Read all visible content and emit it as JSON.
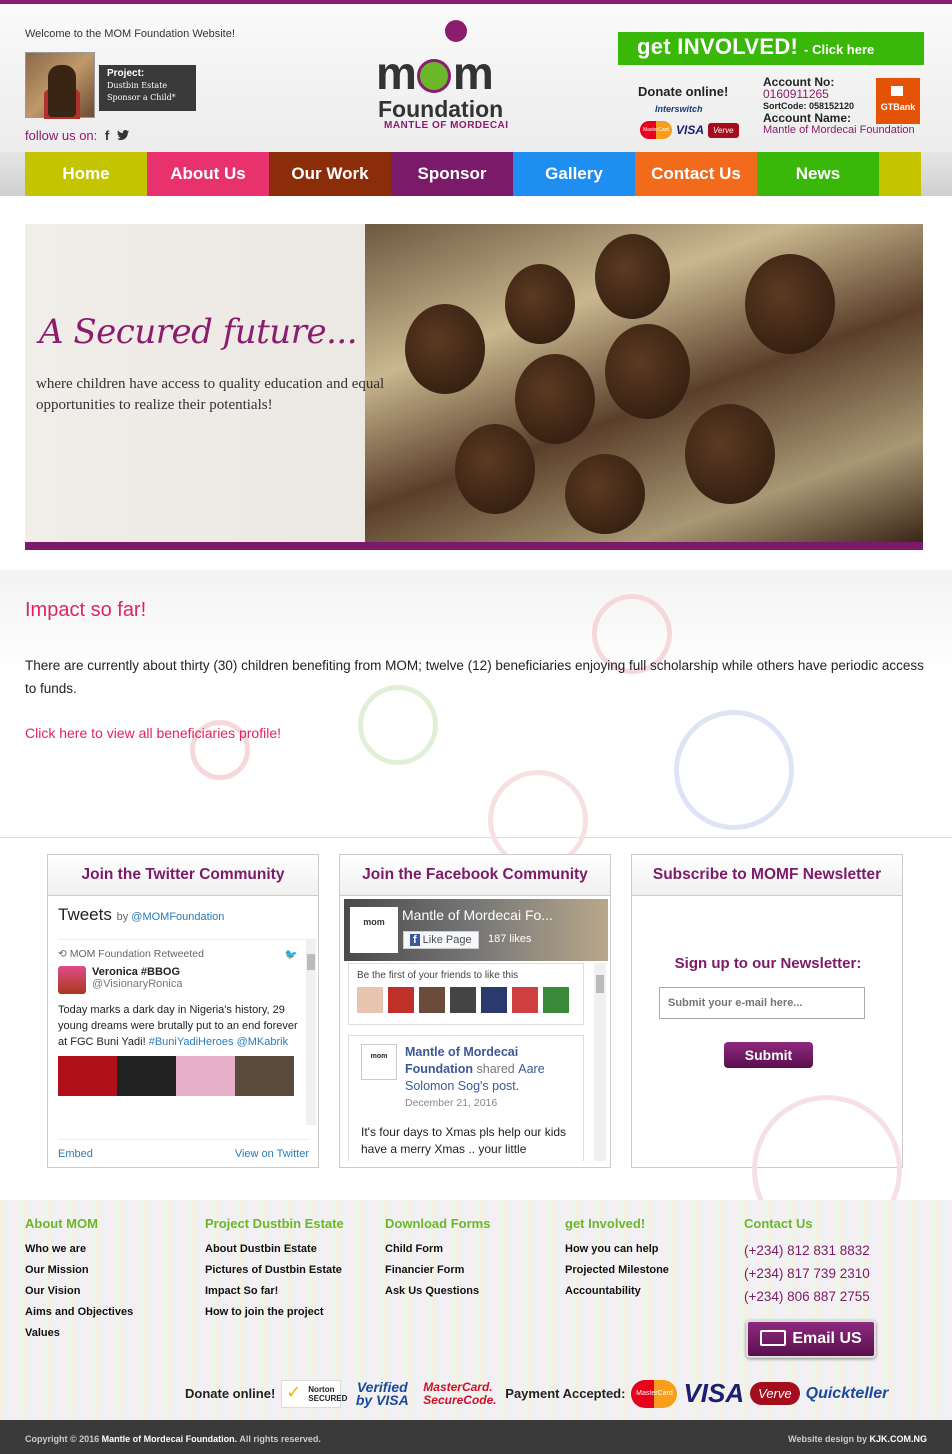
{
  "header": {
    "welcome": "Welcome to the MOM Foundation Website!",
    "project_label": "Project:",
    "project_name": "Dustbin Estate",
    "project_action": "Sponsor a Child*",
    "follow_label": "follow us on:",
    "social_icons": [
      "facebook-icon",
      "twitter-icon"
    ],
    "logo_word": "MOM",
    "logo_foundation": "Foundation",
    "logo_sub": "MANTLE OF MORDECAI",
    "get_involved": "get INVOLVED!",
    "get_involved_cta": "- Click here",
    "donate_label": "Donate online!",
    "interswitch": "Interswitch",
    "card_labels": {
      "mastercard": "MasterCard",
      "visa": "VISA",
      "verve": "Verve"
    },
    "account_no_label": "Account No:",
    "account_no": "0160911265",
    "sort_code": "SortCode: 058152120",
    "account_name_label": "Account Name:",
    "account_name": "Mantle of Mordecai Foundation",
    "bank": "GTBank"
  },
  "nav": [
    {
      "label": "Home",
      "color": "#c5c400"
    },
    {
      "label": "About Us",
      "color": "#e8326e"
    },
    {
      "label": "Our Work",
      "color": "#8a2d08"
    },
    {
      "label": "Sponsor",
      "color": "#7c1a6a"
    },
    {
      "label": "Gallery",
      "color": "#1e8ef0"
    },
    {
      "label": "Contact Us",
      "color": "#f26a1b"
    },
    {
      "label": "News",
      "color": "#3ab80a"
    }
  ],
  "banner": {
    "tagline": "A Secured future...",
    "description": "where children have access to quality education and equal opportunities to realize their potentials!"
  },
  "impact": {
    "title": "Impact so far!",
    "text": "There are currently about thirty (30) children benefiting from MOM; twelve (12) beneficiaries enjoying full scholarship while others have periodic access to funds.",
    "link": "Click here to view all beneficiaries profile!"
  },
  "twitter": {
    "heading": "Join the Twitter Community",
    "title": "Tweets",
    "by": "by",
    "handle": "@MOMFoundation",
    "retweeted": "MOM Foundation Retweeted",
    "user": "Veronica #BBOG",
    "user_handle": "@VisionaryRonica",
    "tweet": "Today marks a dark day in Nigeria's history, 29 young dreams were brutally put to an end forever at FGC Buni Yadi!",
    "hashtag": "#BuniYadiHeroes",
    "mention": "@MKabrik",
    "embed": "Embed",
    "view": "View on Twitter"
  },
  "facebook": {
    "heading": "Join the Facebook Community",
    "page_name": "Mantle of Mordecai Fo...",
    "like": "Like Page",
    "likes": "187 likes",
    "friends_text": "Be the first of your friends to like this",
    "post_author": "Mantle of Mordecai Foundation",
    "post_shared": "shared",
    "post_source": "Aare Solomon Sog's post.",
    "post_date": "December 21, 2016",
    "post_text": "It's four days to Xmas pls help our kids have a merry Xmas .. your little donation will go a long way...these"
  },
  "newsletter": {
    "heading": "Subscribe to MOMF Newsletter",
    "title": "Sign up to our Newsletter:",
    "placeholder": "Submit your e-mail here...",
    "submit": "Submit"
  },
  "footer": {
    "columns": [
      {
        "title": "About MOM",
        "items": [
          "Who we are",
          "Our Mission",
          "Our Vision",
          "Aims and Objectives",
          "Values"
        ]
      },
      {
        "title": "Project Dustbin Estate",
        "items": [
          "About Dustbin Estate",
          "Pictures of Dustbin Estate",
          "Impact So far!",
          "How to join the project"
        ]
      },
      {
        "title": "Download Forms",
        "items": [
          "Child Form",
          "Financier Form",
          "Ask Us Questions"
        ]
      },
      {
        "title": "get Involved!",
        "items": [
          "How you can help",
          "Projected Milestone",
          "Accountability"
        ]
      }
    ],
    "contact_title": "Contact Us",
    "phones": [
      "(+234) 812 831 8832",
      "(+234) 817 739 2310",
      "(+234) 806 887 2755"
    ],
    "email_btn": "Email US",
    "donate_label": "Donate online!",
    "norton": "Norton SECURED",
    "verified": "Verified by VISA",
    "mc_secure": "MasterCard. SecureCode.",
    "payment_label": "Payment Accepted:",
    "pay_mc": "MasterCard",
    "pay_visa": "VISA",
    "pay_verve": "Verve",
    "pay_qt": "Quickteller"
  },
  "bottom": {
    "copyright": "Copyright © 2016",
    "org": "Mantle of Mordecai Foundation.",
    "rights": "All rights reserved.",
    "design_label": "Website design by",
    "designer": "KJK.COM.NG"
  }
}
